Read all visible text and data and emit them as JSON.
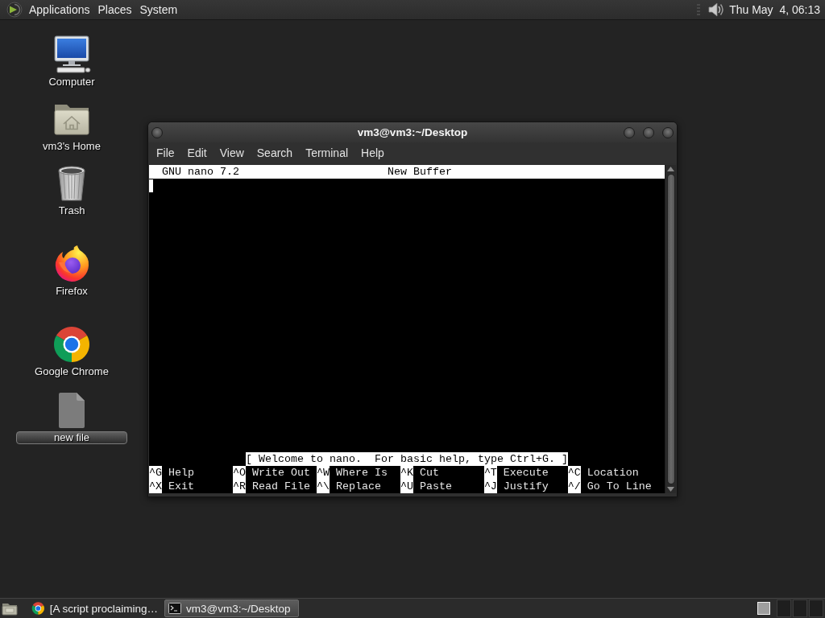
{
  "top_panel": {
    "menus": [
      "Applications",
      "Places",
      "System"
    ],
    "clock": "Thu May  4, 06:13"
  },
  "desktop_icons": [
    {
      "label": "Computer",
      "kind": "computer",
      "selected": false
    },
    {
      "label": "vm3's Home",
      "kind": "home",
      "selected": false
    },
    {
      "label": "Trash",
      "kind": "trash",
      "selected": false
    },
    {
      "label": "Firefox",
      "kind": "firefox",
      "selected": false
    },
    {
      "label": "Google Chrome",
      "kind": "chrome",
      "selected": false
    },
    {
      "label": "new file",
      "kind": "file",
      "selected": true
    }
  ],
  "terminal_window": {
    "title": "vm3@vm3:~/Desktop",
    "menu": [
      "File",
      "Edit",
      "View",
      "Search",
      "Terminal",
      "Help"
    ],
    "nano": {
      "version": "GNU nano 7.2",
      "buffer": "New Buffer",
      "status": "[ Welcome to nano.  For basic help, type Ctrl+G. ]",
      "shortcut_rows": [
        {
          "items": [
            {
              "key": "^G",
              "label": "Help"
            },
            {
              "key": "^O",
              "label": "Write Out"
            },
            {
              "key": "^W",
              "label": "Where Is"
            },
            {
              "key": "^K",
              "label": "Cut"
            },
            {
              "key": "^T",
              "label": "Execute"
            },
            {
              "key": "^C",
              "label": "Location"
            }
          ]
        },
        {
          "items": [
            {
              "key": "^X",
              "label": "Exit"
            },
            {
              "key": "^R",
              "label": "Read File"
            },
            {
              "key": "^\\",
              "label": "Replace"
            },
            {
              "key": "^U",
              "label": "Paste"
            },
            {
              "key": "^J",
              "label": "Justify"
            },
            {
              "key": "^/",
              "label": "Go To Line"
            }
          ]
        }
      ]
    }
  },
  "taskbar": {
    "items": [
      {
        "label": "[A script proclaiming…",
        "kind": "chrome",
        "selected": false
      },
      {
        "label": "vm3@vm3:~/Desktop",
        "kind": "terminal",
        "selected": true
      }
    ]
  }
}
